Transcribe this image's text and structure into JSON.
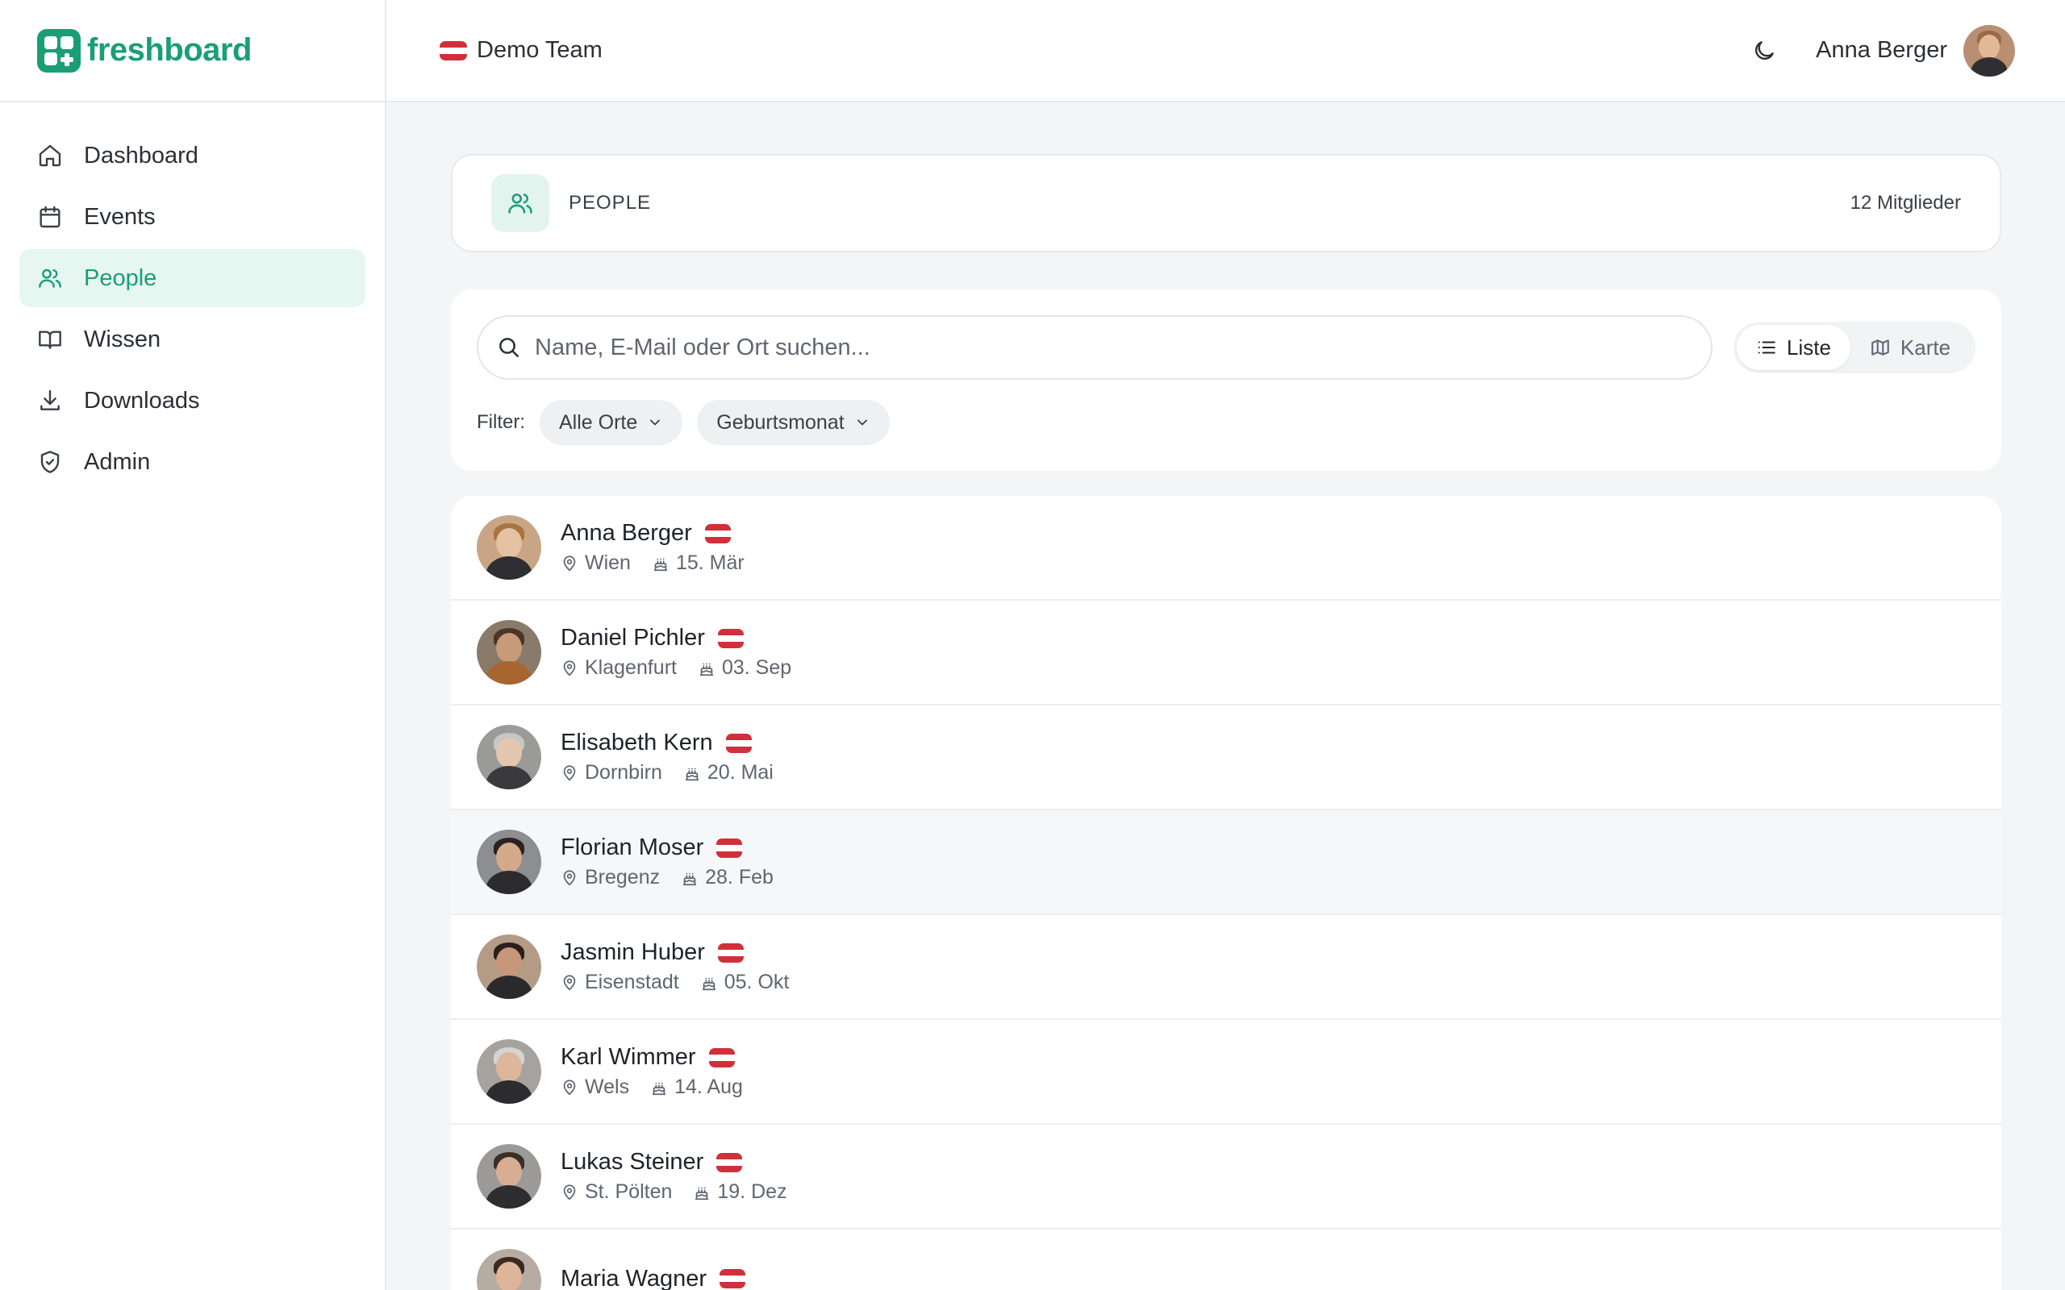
{
  "app": {
    "logo_text": "freshboard"
  },
  "topbar": {
    "team_name": "Demo Team",
    "user_name": "Anna Berger"
  },
  "sidebar": {
    "items": [
      {
        "label": "Dashboard",
        "icon": "home-icon"
      },
      {
        "label": "Events",
        "icon": "calendar-icon"
      },
      {
        "label": "People",
        "icon": "users-icon",
        "active": true
      },
      {
        "label": "Wissen",
        "icon": "book-icon"
      },
      {
        "label": "Downloads",
        "icon": "download-icon"
      },
      {
        "label": "Admin",
        "icon": "shield-icon"
      }
    ]
  },
  "header": {
    "title": "PEOPLE",
    "member_count": "12 Mitglieder"
  },
  "search": {
    "placeholder": "Name, E-Mail oder Ort suchen..."
  },
  "view_toggle": {
    "list_label": "Liste",
    "map_label": "Karte",
    "selected": "Liste"
  },
  "filters": {
    "label": "Filter:",
    "location": "Alle Orte",
    "birth_month": "Geburtsmonat"
  },
  "colors": {
    "accent": "#1a9e76",
    "accent_light": "#e6f6f0",
    "flag_red": "#d1303a"
  },
  "people": [
    {
      "name": "Anna Berger",
      "city": "Wien",
      "birthday": "15. Mär"
    },
    {
      "name": "Daniel Pichler",
      "city": "Klagenfurt",
      "birthday": "03. Sep"
    },
    {
      "name": "Elisabeth Kern",
      "city": "Dornbirn",
      "birthday": "20. Mai"
    },
    {
      "name": "Florian Moser",
      "city": "Bregenz",
      "birthday": "28. Feb"
    },
    {
      "name": "Jasmin Huber",
      "city": "Eisenstadt",
      "birthday": "05. Okt"
    },
    {
      "name": "Karl Wimmer",
      "city": "Wels",
      "birthday": "14. Aug"
    },
    {
      "name": "Lukas Steiner",
      "city": "St. Pölten",
      "birthday": "19. Dez"
    },
    {
      "name": "Maria Wagner",
      "city": "",
      "birthday": ""
    }
  ]
}
